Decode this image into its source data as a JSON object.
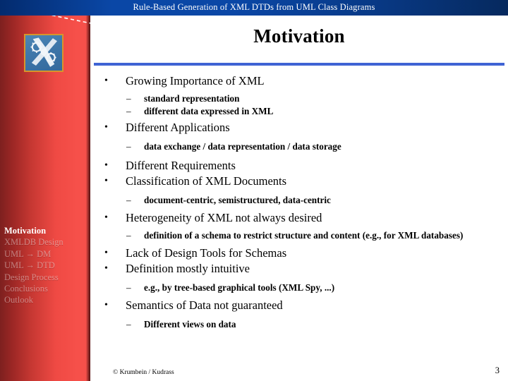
{
  "banner": {
    "title": "Rule-Based Generation of XML DTDs from UML Class Diagrams"
  },
  "colors": {
    "banner_blue": "#0a47a6",
    "sidebar_red": "#f6504a",
    "sidebar_dark": "#7d201f",
    "rule_blue": "#3f63d4",
    "logo_border": "#d7952b",
    "logo_bg": "#3f78ab"
  },
  "sidebar": {
    "logo_name": "institute-logo",
    "items": [
      {
        "label": "Motivation",
        "active": true
      },
      {
        "label": "XMLDB Design",
        "active": false
      },
      {
        "label": "UML → DM",
        "active": false
      },
      {
        "label": "UML → DTD",
        "active": false
      },
      {
        "label": "Design Process",
        "active": false
      },
      {
        "label": "Conclusions",
        "active": false
      },
      {
        "label": "Outlook",
        "active": false
      }
    ]
  },
  "slide": {
    "title": "Motivation",
    "bullets": [
      {
        "level": 1,
        "marker": "•",
        "text": "Growing Importance of XML"
      },
      {
        "level": 2,
        "marker": "–",
        "text": "standard representation"
      },
      {
        "level": 2,
        "marker": "–",
        "text": "different data  expressed in XML"
      },
      {
        "level": 1,
        "marker": "•",
        "text": "Different Applications"
      },
      {
        "level": 2,
        "marker": "–",
        "text": "data exchange / data representation / data storage"
      },
      {
        "level": 1,
        "marker": "•",
        "text": "Different Requirements"
      },
      {
        "level": 1,
        "marker": "•",
        "text": "Classification of XML Documents"
      },
      {
        "level": 2,
        "marker": "–",
        "text": "document-centric, semistructured, data-centric"
      },
      {
        "level": 1,
        "marker": "•",
        "text": "Heterogeneity of XML not always desired"
      },
      {
        "level": 2,
        "marker": "–",
        "text": "definition of a schema to restrict structure and content (e.g., for XML databases)"
      },
      {
        "level": 1,
        "marker": "•",
        "text": "Lack of Design Tools for Schemas"
      },
      {
        "level": 1,
        "marker": "•",
        "text": "Definition mostly intuitive"
      },
      {
        "level": 2,
        "marker": "–",
        "text": "e.g., by tree-based graphical tools (XML Spy, ...)"
      },
      {
        "level": 1,
        "marker": "•",
        "text": "Semantics of Data not guaranteed"
      },
      {
        "level": 2,
        "marker": "–",
        "text": "Different views on data"
      }
    ]
  },
  "footer": {
    "copyright": "© Krumbein / Kudrass",
    "page_number": "3"
  }
}
